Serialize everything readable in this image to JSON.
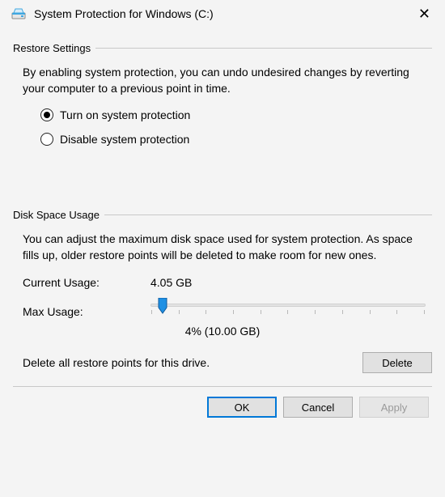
{
  "title": "System Protection for Windows (C:)",
  "restore": {
    "header": "Restore Settings",
    "desc": "By enabling system protection, you can undo undesired changes by reverting your computer to a previous point in time.",
    "opt_on": "Turn on system protection",
    "opt_off": "Disable system protection",
    "selected": "on"
  },
  "disk": {
    "header": "Disk Space Usage",
    "desc": "You can adjust the maximum disk space used for system protection. As space fills up, older restore points will be deleted to make room for new ones.",
    "current_label": "Current Usage:",
    "current_value": "4.05 GB",
    "max_label": "Max Usage:",
    "max_percent": 4,
    "max_display": "4% (10.00 GB)",
    "delete_text": "Delete all restore points for this drive.",
    "delete_btn": "Delete"
  },
  "footer": {
    "ok": "OK",
    "cancel": "Cancel",
    "apply": "Apply"
  }
}
